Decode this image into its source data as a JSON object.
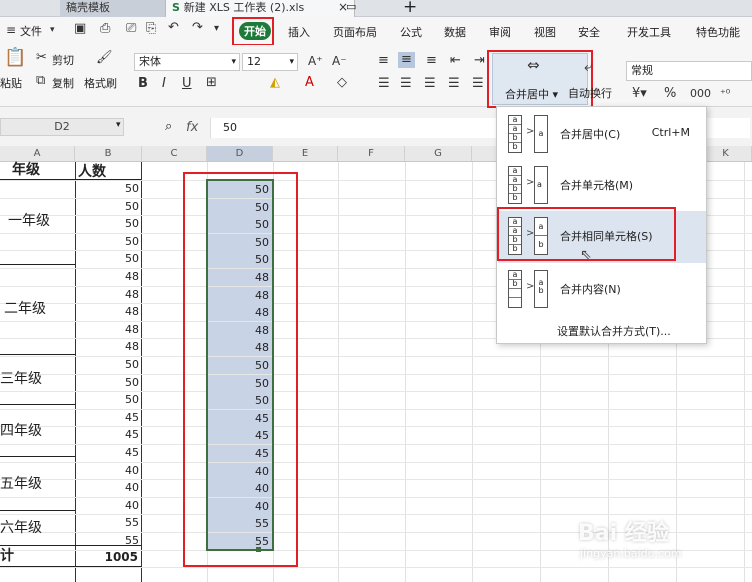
{
  "titlebar": {
    "tab1": "稿壳模板",
    "tab2": "新建 XLS 工作表 (2).xls",
    "new_tab": "+"
  },
  "menu": {
    "file": "文件",
    "items": [
      "开始",
      "插入",
      "页面布局",
      "公式",
      "数据",
      "审阅",
      "视图",
      "安全",
      "开发工具",
      "特色功能"
    ]
  },
  "ribbon": {
    "paste": "粘贴",
    "cut": "剪切",
    "copy": "复制",
    "format_painter": "格式刷",
    "font_name": "宋体",
    "font_size": "12",
    "merge_center": "合并居中",
    "auto_wrap": "自动换行",
    "number_format": "常规"
  },
  "formula": {
    "cell_ref": "D2",
    "fx": "fx",
    "value": "50"
  },
  "columns": [
    "A",
    "B",
    "C",
    "D",
    "E",
    "F",
    "G",
    "K"
  ],
  "headers": {
    "grade": "年级",
    "count": "人数"
  },
  "grades": [
    "一年级",
    "二年级",
    "三年级",
    "四年级",
    "五年级",
    "六年级"
  ],
  "total_label": "计",
  "total_value": "1005",
  "b_values": [
    "50",
    "50",
    "50",
    "50",
    "50",
    "48",
    "48",
    "48",
    "48",
    "48",
    "50",
    "50",
    "50",
    "45",
    "45",
    "45",
    "40",
    "40",
    "40",
    "55",
    "55"
  ],
  "d_values": [
    "50",
    "50",
    "50",
    "50",
    "50",
    "48",
    "48",
    "48",
    "48",
    "48",
    "50",
    "50",
    "50",
    "45",
    "45",
    "45",
    "40",
    "40",
    "40",
    "55",
    "55"
  ],
  "dropdown": {
    "items": [
      {
        "label": "合并居中(C)",
        "shortcut": "Ctrl+M"
      },
      {
        "label": "合并单元格(M)",
        "shortcut": ""
      },
      {
        "label": "合并相同单元格(S)",
        "shortcut": ""
      },
      {
        "label": "合并内容(N)",
        "shortcut": ""
      }
    ],
    "footer": "设置默认合并方式(T)..."
  },
  "watermark": {
    "brand": "Bai 经验",
    "url": "jingyan.baidu.com"
  },
  "colors": {
    "accent_green": "#1f7a3a",
    "selection": "#c9d3e6",
    "highlight_red": "#e21f26"
  }
}
